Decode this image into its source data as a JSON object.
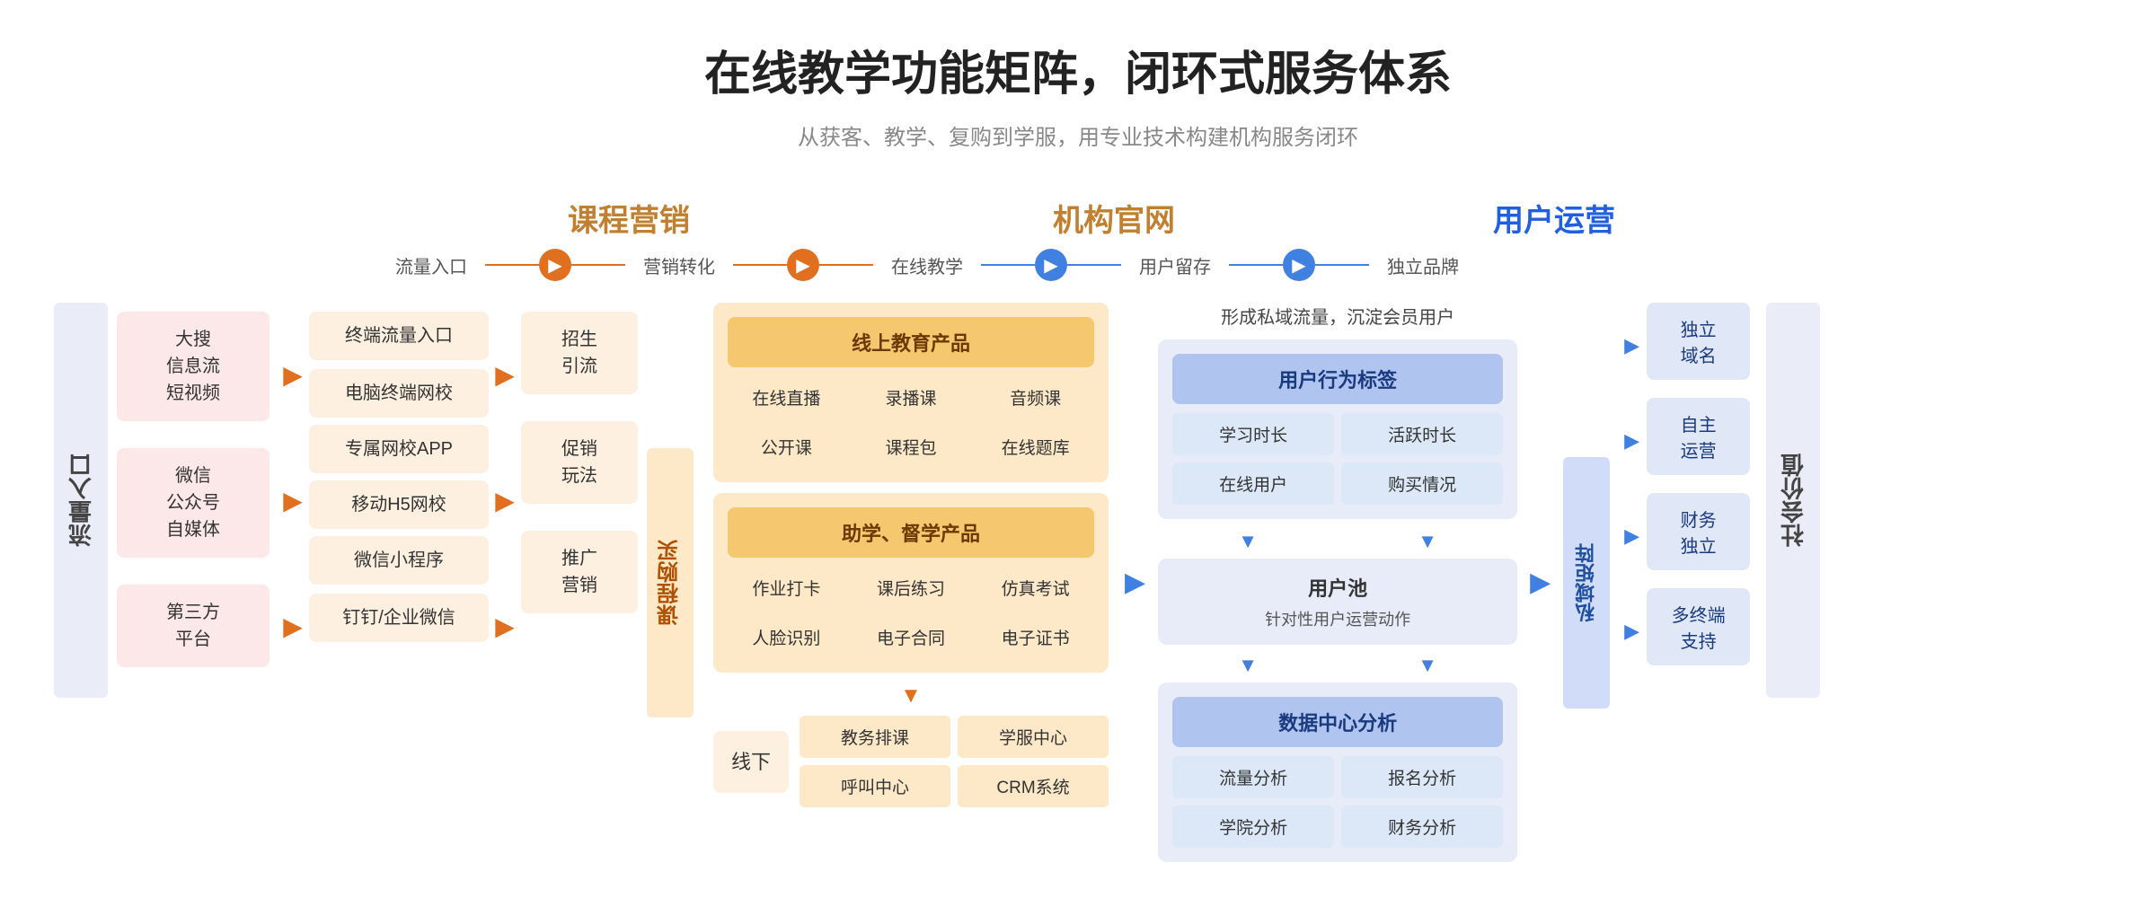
{
  "title": "在线教学功能矩阵，闭环式服务体系",
  "subtitle": "从获客、教学、复购到学服，用专业技术构建机构服务闭环",
  "sectionHeaders": {
    "marketing": "课程营销",
    "official": "机构官网",
    "operation": "用户运营"
  },
  "flowSteps": [
    "流量入口",
    "营销转化",
    "在线教学",
    "用户留存",
    "独立品牌"
  ],
  "leftLabel": "流量入口",
  "trafficSources": [
    {
      "name": "大搜\n信息流\n短视频"
    },
    {
      "name": "微信\n公众号\n自媒体"
    },
    {
      "name": "第三方\n平台"
    }
  ],
  "marketingItems": [
    {
      "name": "终端流量入口"
    },
    {
      "name": "电脑终端网校"
    },
    {
      "name": "专属网校APP"
    },
    {
      "name": "移动H5网校"
    },
    {
      "name": "微信小程序"
    },
    {
      "name": "钉钉/企业微信"
    }
  ],
  "promoItems": [
    {
      "name": "招生\n引流"
    },
    {
      "name": "促销\n玩法"
    },
    {
      "name": "推广\n营销"
    }
  ],
  "courseBuyLabel": "课程购买",
  "onlineTeaching": {
    "productHeader": "线上教育产品",
    "products": [
      "在线直播",
      "录播课",
      "音频课",
      "公开课",
      "课程包",
      "在线题库"
    ],
    "assistHeader": "助学、督学产品",
    "assists": [
      "作业打卡",
      "课后练习",
      "仿真考试",
      "人脸识别",
      "电子合同",
      "电子证书"
    ],
    "offline": "线下",
    "offlineItems": [
      "教务排课",
      "学服中心",
      "呼叫中心",
      "CRM系统"
    ]
  },
  "userRetention": {
    "topText": "形成私域流量，沉淀会员用户",
    "behaviorHeader": "用户行为标签",
    "behaviorItems": [
      "学习时长",
      "活跃时长",
      "在线用户",
      "购买情况"
    ],
    "userPool": "用户池",
    "userPoolSub": "针对性用户运营动作",
    "dataHeader": "数据中心分析",
    "dataItems": [
      "流量分析",
      "报名分析",
      "学院分析",
      "财务分析"
    ]
  },
  "privateDomainLabel": "私域矩阵",
  "brandItems": [
    "独立\n域名",
    "自主\n运营",
    "财务\n独立",
    "多终端\n支持"
  ],
  "socialValueLabel": "社会价值"
}
